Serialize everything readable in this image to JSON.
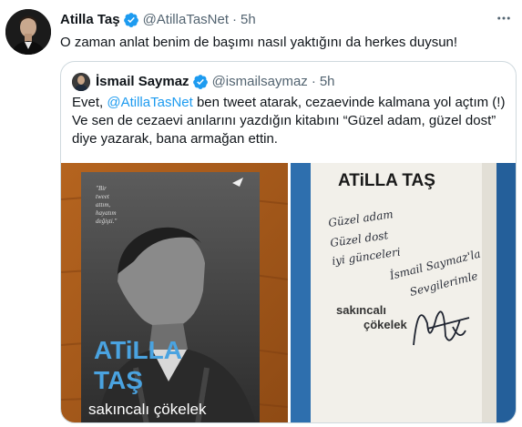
{
  "tweet": {
    "author_name": "Atilla Taş",
    "author_handle": "@AtillaTasNet",
    "separator": "·",
    "time": "5h",
    "text": "O zaman anlat benim de başımı nasıl yaktığını da herkes duysun!"
  },
  "quote": {
    "author_name": "İsmail Saymaz",
    "author_handle": "@ismailsaymaz",
    "separator": "·",
    "time": "5h",
    "line1_prefix": "Evet, ",
    "line1_mention": "@AtillaTasNet",
    "line1_suffix": " ben tweet atarak, cezaevinde kalmana yol açtım (!)",
    "line2": "Ve sen de cezaevi anılarını yazdığın kitabını “Güzel adam, güzel dost”",
    "line3": "diye yazarak, bana armağan ettin."
  },
  "book_cover": {
    "author_first": "ATiLLA",
    "author_last": "TAŞ",
    "title": "sakıncalı çökelek",
    "quote_lines": [
      "\"Bir",
      "tweet",
      "attım,",
      "hayatım",
      "değişti.\""
    ]
  },
  "inscription_page": {
    "author": "ATiLLA TAŞ",
    "handwritten_lines": [
      "Güzel adam",
      "Güzel dost",
      "iyi günceleri",
      "İsmail Saymaz'la",
      "Sevgilerimle"
    ],
    "title_line1": "sakıncalı",
    "title_line2": "çökelek"
  },
  "icons": {
    "verified": "verified-badge-icon",
    "more": "more-horizontal-icon"
  },
  "colors": {
    "verified_blue": "#1d9bf0",
    "mention_blue": "#1d9bf0",
    "secondary_text": "#536471",
    "border": "#cfd9de"
  }
}
